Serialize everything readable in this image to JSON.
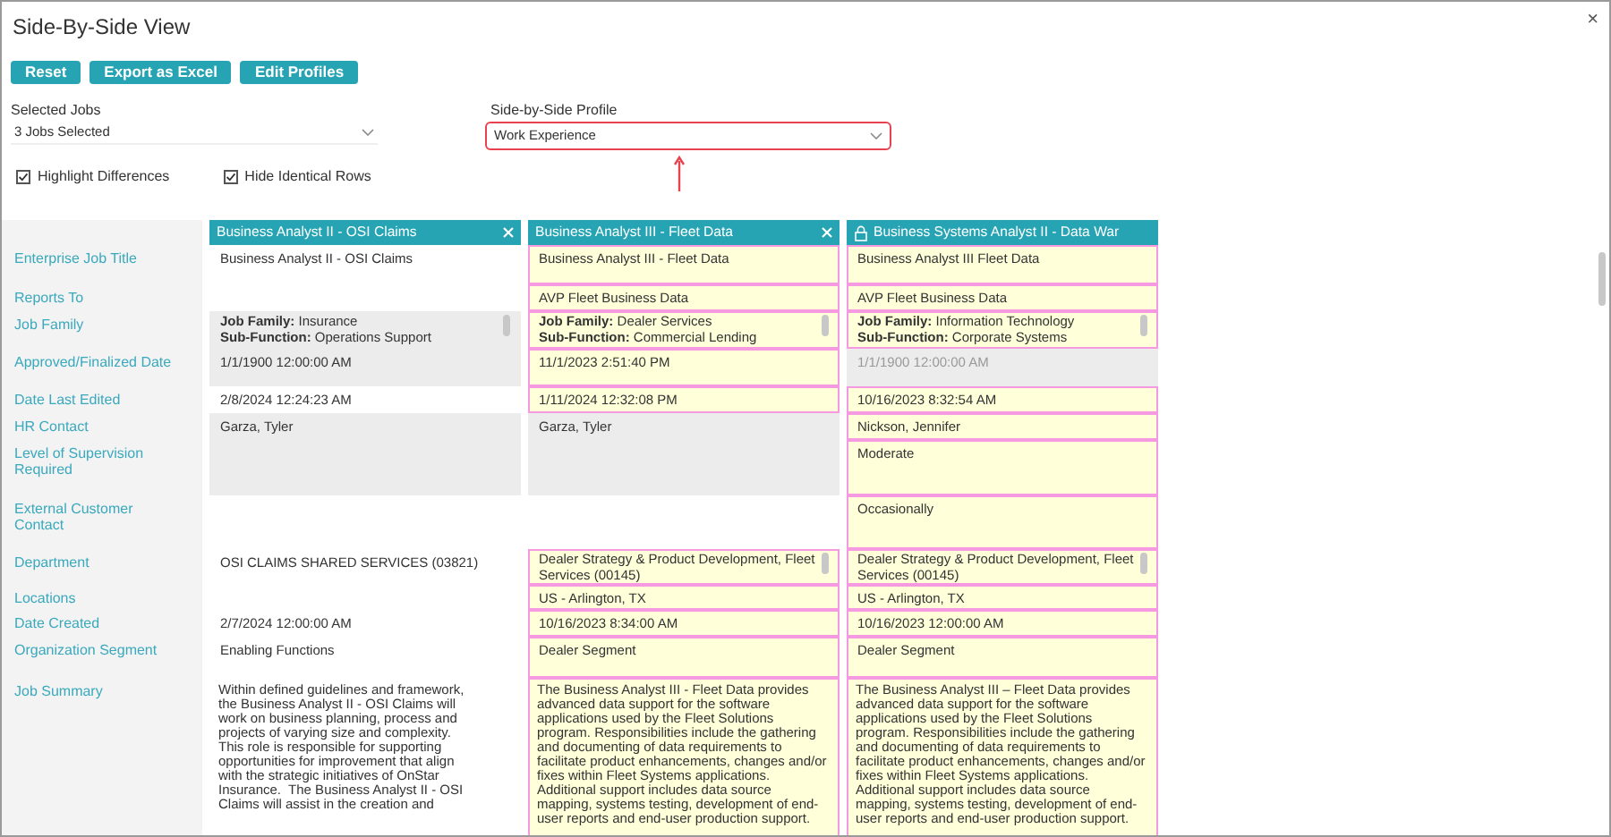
{
  "window": {
    "title": "Side-By-Side View",
    "close": "×"
  },
  "toolbar": {
    "buttons": [
      "Reset",
      "Export as Excel",
      "Edit Profiles"
    ]
  },
  "selected_jobs": {
    "label": "Selected Jobs",
    "value": "3 Jobs Selected"
  },
  "profile": {
    "label": "Side-by-Side Profile",
    "value": "Work Experience",
    "highlighted": true
  },
  "options": [
    {
      "label": "Highlight Differences",
      "checked": true
    },
    {
      "label": "Hide Identical Rows",
      "checked": true
    }
  ],
  "row_labels": [
    "Enterprise Job Title",
    "Reports To",
    "Job Family",
    "Approved/Finalized Date",
    "Date Last Edited",
    "HR Contact",
    "Level of Supervision Required",
    "External Customer Contact",
    "Department",
    "Locations",
    "Date Created",
    "Organization Segment",
    "Job Summary"
  ],
  "jobs": [
    {
      "title": "Business Analyst II - OSI Claims",
      "removable": true,
      "locked": false,
      "cells": [
        {
          "kind": "text",
          "text": "Business Analyst II - OSI Claims",
          "highlighted": false,
          "shaded": false,
          "muted": false
        },
        {
          "kind": "empty"
        },
        {
          "kind": "scroll",
          "lines": [
            "**Job Family:** Insurance",
            "**Sub-Function:** Operations Support"
          ],
          "highlighted": false,
          "shaded": true,
          "muted": false
        },
        {
          "kind": "text",
          "text": "1/1/1900 12:00:00 AM",
          "highlighted": false,
          "shaded": true,
          "muted": false
        },
        {
          "kind": "text",
          "text": "2/8/2024 12:24:23 AM",
          "highlighted": false,
          "shaded": false,
          "muted": false
        },
        {
          "kind": "text",
          "text": "Garza, Tyler",
          "highlighted": false,
          "shaded": true,
          "muted": false
        },
        {
          "kind": "empty",
          "highlighted": false,
          "shaded": true
        },
        {
          "kind": "empty"
        },
        {
          "kind": "text",
          "text": "OSI CLAIMS SHARED SERVICES (03821)",
          "highlighted": false,
          "shaded": false,
          "muted": false
        },
        {
          "kind": "empty"
        },
        {
          "kind": "text",
          "text": "2/7/2024 12:00:00 AM",
          "highlighted": false,
          "shaded": false,
          "muted": false
        },
        {
          "kind": "text",
          "text": "Enabling Functions",
          "highlighted": false,
          "shaded": false,
          "muted": false
        },
        {
          "kind": "summary",
          "lines": [
            "Within defined guidelines and framework,",
            "the Business Analyst II - OSI Claims will",
            "work on business planning, process and",
            "projects of varying size and complexity.",
            "This role is responsible for supporting",
            "opportunities for improvement that align",
            "with the strategic initiatives of OnStar",
            "Insurance.  The Business Analyst II - OSI",
            "Claims will assist in the creation and"
          ],
          "highlighted": false,
          "shaded": false,
          "muted": false
        }
      ]
    },
    {
      "title": "Business Analyst III - Fleet Data",
      "removable": true,
      "locked": false,
      "cells": [
        {
          "kind": "text",
          "text": "Business Analyst III - Fleet Data",
          "highlighted": true,
          "shaded": false,
          "muted": false
        },
        {
          "kind": "text",
          "text": "AVP Fleet Business Data",
          "highlighted": true,
          "shaded": false,
          "muted": false
        },
        {
          "kind": "scroll",
          "lines": [
            "**Job Family:** Dealer Services",
            "**Sub-Function:** Commercial Lending"
          ],
          "highlighted": true,
          "shaded": false,
          "muted": false
        },
        {
          "kind": "text",
          "text": "11/1/2023 2:51:40 PM",
          "highlighted": true,
          "shaded": false,
          "muted": false
        },
        {
          "kind": "text",
          "text": "1/11/2024 12:32:08 PM",
          "highlighted": true,
          "shaded": false,
          "muted": false
        },
        {
          "kind": "text",
          "text": "Garza, Tyler",
          "highlighted": false,
          "shaded": true,
          "muted": false
        },
        {
          "kind": "empty",
          "highlighted": false,
          "shaded": true
        },
        {
          "kind": "empty"
        },
        {
          "kind": "scroll",
          "lines": [
            "Dealer Strategy & Product Development, Fleet",
            "Services (00145)"
          ],
          "highlighted": true,
          "shaded": false,
          "muted": false
        },
        {
          "kind": "text",
          "text": "US - Arlington, TX",
          "highlighted": true,
          "shaded": false,
          "muted": false
        },
        {
          "kind": "text",
          "text": "10/16/2023 8:34:00 AM",
          "highlighted": true,
          "shaded": false,
          "muted": false
        },
        {
          "kind": "text",
          "text": "Dealer Segment",
          "highlighted": true,
          "shaded": false,
          "muted": false
        },
        {
          "kind": "summary",
          "lines": [
            "The Business Analyst III - Fleet Data provides",
            "advanced data support for the software",
            "applications used by the Fleet Solutions",
            "program. Responsibilities include the gathering",
            "and documenting of data requirements to",
            "facilitate product enhancements, changes and/or",
            "fixes within Fleet Systems applications.",
            "Additional support includes data source",
            "mapping, systems testing, development of end-",
            "user reports and end-user production support."
          ],
          "highlighted": true,
          "shaded": false,
          "muted": false
        }
      ]
    },
    {
      "title": "Business Systems Analyst II - Data War",
      "removable": false,
      "locked": true,
      "cells": [
        {
          "kind": "text",
          "text": "Business Analyst III Fleet Data",
          "highlighted": true,
          "shaded": false,
          "muted": false
        },
        {
          "kind": "text",
          "text": "AVP Fleet Business Data",
          "highlighted": true,
          "shaded": false,
          "muted": false
        },
        {
          "kind": "scroll",
          "lines": [
            "**Job Family:** Information Technology",
            "**Sub-Function:** Corporate Systems"
          ],
          "highlighted": true,
          "shaded": false,
          "muted": false
        },
        {
          "kind": "text",
          "text": "1/1/1900 12:00:00 AM",
          "highlighted": false,
          "shaded": true,
          "muted": true
        },
        {
          "kind": "text",
          "text": "10/16/2023 8:32:54 AM",
          "highlighted": true,
          "shaded": false,
          "muted": false
        },
        {
          "kind": "text",
          "text": "Nickson, Jennifer",
          "highlighted": true,
          "shaded": false,
          "muted": false
        },
        {
          "kind": "text",
          "text": "Moderate",
          "highlighted": true,
          "shaded": false,
          "muted": false
        },
        {
          "kind": "text",
          "text": "Occasionally",
          "highlighted": true,
          "shaded": false,
          "muted": false
        },
        {
          "kind": "scroll",
          "lines": [
            "Dealer Strategy & Product Development, Fleet",
            "Services (00145)"
          ],
          "highlighted": true,
          "shaded": false,
          "muted": false
        },
        {
          "kind": "text",
          "text": "US - Arlington, TX",
          "highlighted": true,
          "shaded": false,
          "muted": false
        },
        {
          "kind": "text",
          "text": "10/16/2023 12:00:00 AM",
          "highlighted": true,
          "shaded": false,
          "muted": false
        },
        {
          "kind": "text",
          "text": "Dealer Segment",
          "highlighted": true,
          "shaded": false,
          "muted": false
        },
        {
          "kind": "summary",
          "lines": [
            "The Business Analyst III – Fleet Data provides",
            "advanced data support for the software",
            "applications used by the Fleet Solutions",
            "program. Responsibilities include the gathering",
            "and documenting of data requirements to",
            "facilitate product enhancements, changes and/or",
            "fixes within Fleet Systems applications.",
            "Additional support includes data source",
            "mapping, systems testing, development of end-",
            "user reports and end-user production support."
          ],
          "highlighted": true,
          "shaded": false,
          "muted": false
        }
      ]
    }
  ]
}
